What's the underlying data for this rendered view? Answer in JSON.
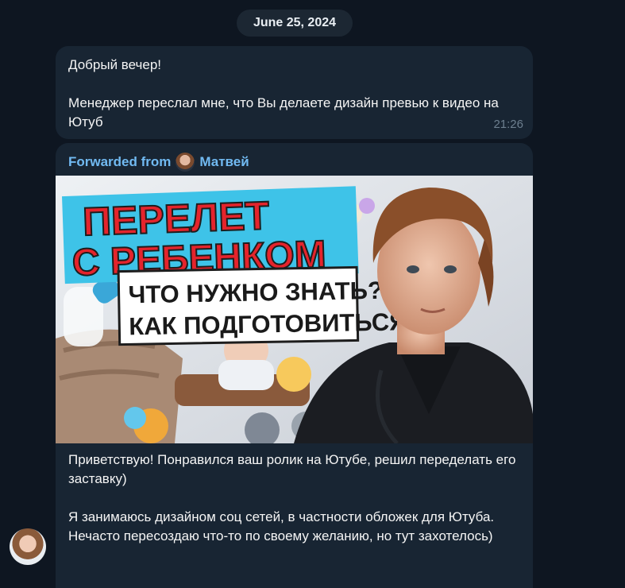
{
  "date_separator": "June 25, 2024",
  "message1": {
    "lines": [
      "Добрый вечер!",
      "",
      "Менеджер переслал мне, что Вы делаете дизайн превью к видео на Ютуб"
    ],
    "time": "21:26"
  },
  "message2": {
    "forwarded_prefix": "Forwarded from",
    "forwarded_name": "Матвей",
    "thumbnail": {
      "title_line1": "ПЕРЕЛЕТ",
      "title_line2": "С РЕБЕНКОМ",
      "sub_line1": "ЧТО НУЖНО ЗНАТЬ?",
      "sub_line2": "КАК ПОДГОТОВИТЬСЯ?"
    },
    "caption_p1": "Приветствую! Понравился ваш ролик на Ютубе, решил переделать его заставку)",
    "caption_p2": "Я занимаюсь дизайном соц сетей, в частности обложек для Ютуба. Нечасто пересоздаю что-то по своему желанию, но тут захотелось)"
  },
  "colors": {
    "background": "#0e1621",
    "bubble": "#182533",
    "forward_link": "#71baf2",
    "timestamp": "#6d7f8f",
    "thumb_cyan": "#3ec3e8",
    "thumb_red": "#e4242c"
  }
}
